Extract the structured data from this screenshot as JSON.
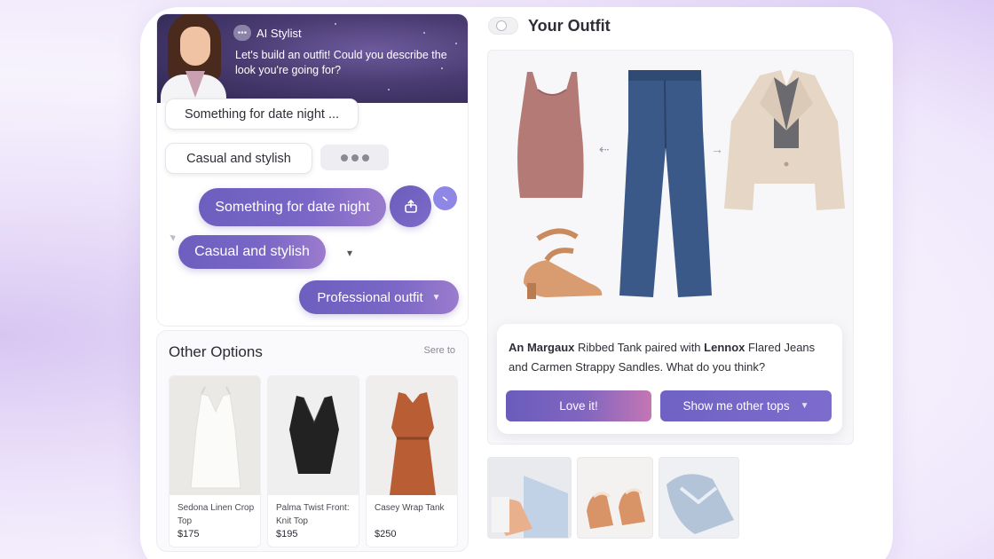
{
  "chat": {
    "bot_name": "AI Stylist",
    "bot_message": "Let's build an outfit! Could you describe the look you're going for?",
    "suggestions": [
      "Something for date night ...",
      "Casual and stylish"
    ],
    "user_messages": [
      "Something for date night",
      "Casual and stylish",
      "Professional outfit"
    ]
  },
  "other_options": {
    "title": "Other Options",
    "see_all": "Sere to",
    "products": [
      {
        "name": "Sedona Linen Crop Top",
        "price": "$175"
      },
      {
        "name": "Palma Twist Front: Knit Top",
        "price": "$195"
      },
      {
        "name": "Casey Wrap Tank",
        "price": "$250"
      }
    ]
  },
  "outfit": {
    "title": "Your Outfit",
    "description_parts": [
      "An Margaux",
      " Ribbed Tank paired with ",
      "Lennox",
      " Flared Jeans and Carmen Strappy Sandles. What do you think?"
    ],
    "love_button": "Love it!",
    "show_button": "Show me other tops"
  },
  "colors": {
    "accent": "#6d5fbf",
    "accent_pink": "#c476b4",
    "header_dark": "#3a3060"
  }
}
